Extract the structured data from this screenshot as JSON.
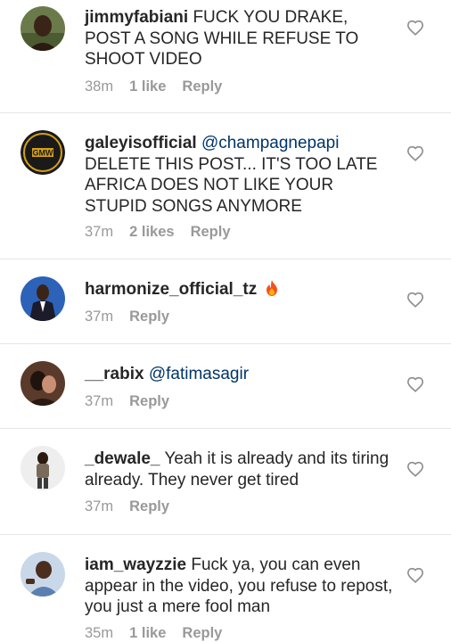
{
  "comments": [
    {
      "username": "jimmyfabiani",
      "text": "FUCK YOU DRAKE,  POST A SONG WHILE REFUSE TO SHOOT VIDEO",
      "time": "38m",
      "likes": "1 like",
      "reply": "Reply"
    },
    {
      "username": "galeyisofficial",
      "mention": "@champagnepapi",
      "text": "DELETE THIS POST... IT'S TOO LATE AFRICA DOES NOT LIKE YOUR STUPID SONGS ANYMORE",
      "time": "37m",
      "likes": "2 likes",
      "reply": "Reply",
      "avatar_text": "GMW"
    },
    {
      "username": "harmonize_official_tz",
      "emoji": "fire-icon",
      "time": "37m",
      "reply": "Reply"
    },
    {
      "username": "__rabix",
      "mention": "@fatimasagir",
      "time": "37m",
      "reply": "Reply"
    },
    {
      "username": "_dewale_",
      "text": "Yeah it is already and its tiring already.  They never get tired",
      "time": "37m",
      "reply": "Reply"
    },
    {
      "username": "iam_wayzzie",
      "text": "Fuck ya, you can even appear in the video, you refuse to repost, you just a mere fool man",
      "time": "35m",
      "likes": "1 like",
      "reply": "Reply"
    }
  ],
  "colors": {
    "text": "#262626",
    "meta": "#999999",
    "mention": "#003569",
    "divider": "#e6e6e6",
    "fire": "#f4511e"
  }
}
